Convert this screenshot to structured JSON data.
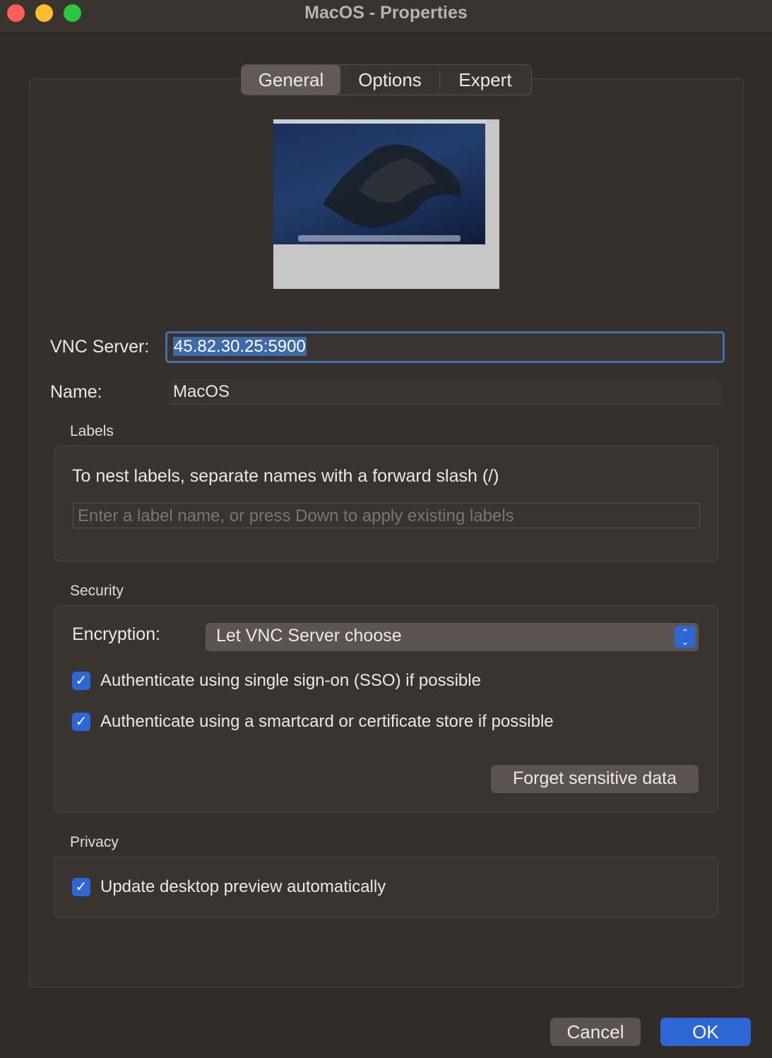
{
  "window": {
    "title": "MacOS - Properties"
  },
  "tabs": [
    {
      "label": "General",
      "selected": true
    },
    {
      "label": "Options",
      "selected": false
    },
    {
      "label": "Expert",
      "selected": false
    }
  ],
  "form": {
    "vnc_server_label": "VNC Server:",
    "vnc_server_value": "45.82.30.25:5900",
    "name_label": "Name:",
    "name_value": "MacOS"
  },
  "labels_section": {
    "title": "Labels",
    "hint": "To nest labels, separate names with a forward slash (/)",
    "input_placeholder": "Enter a label name, or press Down to apply existing labels"
  },
  "security_section": {
    "title": "Security",
    "encryption_label": "Encryption:",
    "encryption_value": "Let VNC Server choose",
    "sso_label": "Authenticate using single sign-on (SSO) if possible",
    "sso_checked": true,
    "smartcard_label": "Authenticate using a smartcard or certificate store if possible",
    "smartcard_checked": true,
    "forget_button": "Forget sensitive data"
  },
  "privacy_section": {
    "title": "Privacy",
    "preview_label": "Update desktop preview automatically",
    "preview_checked": true
  },
  "footer": {
    "cancel": "Cancel",
    "ok": "OK"
  },
  "colors": {
    "accent": "#2f66d6",
    "background": "#322c29"
  }
}
